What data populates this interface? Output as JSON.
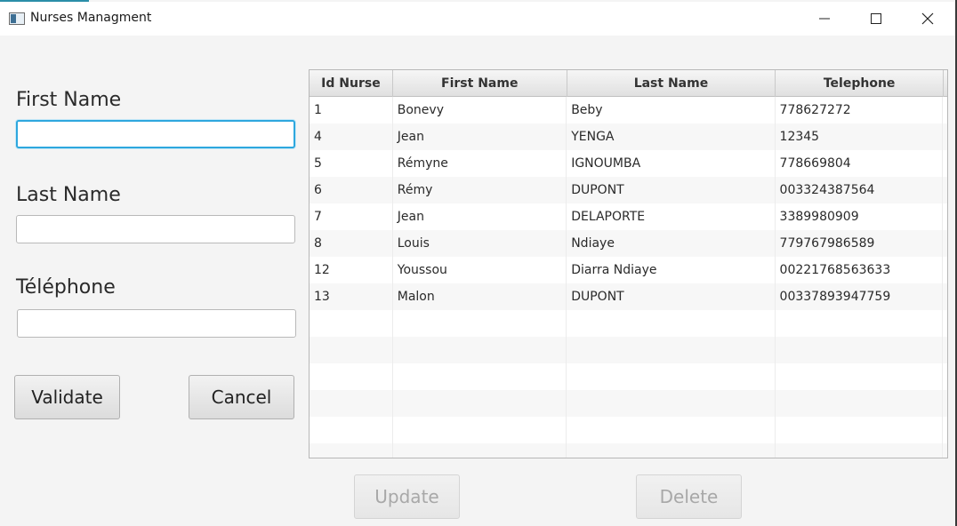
{
  "window": {
    "title": "Nurses Managment"
  },
  "form": {
    "first_name_label": "First Name",
    "first_name_value": "",
    "last_name_label": "Last Name",
    "last_name_value": "",
    "telephone_label": "Téléphone",
    "telephone_value": "",
    "validate_label": "Validate",
    "cancel_label": "Cancel"
  },
  "table": {
    "columns": [
      "Id Nurse",
      "First Name",
      "Last Name",
      "Telephone"
    ],
    "rows": [
      [
        "1",
        "Bonevy",
        "Beby",
        "778627272"
      ],
      [
        "4",
        "Jean",
        "YENGA",
        "12345"
      ],
      [
        "5",
        "Rémyne",
        "IGNOUMBA",
        "778669804"
      ],
      [
        "6",
        "Rémy",
        "DUPONT",
        "003324387564"
      ],
      [
        "7",
        "Jean",
        "DELAPORTE",
        "3389980909"
      ],
      [
        "8",
        "Louis",
        "Ndiaye",
        "779767986589"
      ],
      [
        "12",
        "Youssou",
        "Diarra Ndiaye",
        "00221768563633"
      ],
      [
        "13",
        "Malon",
        "DUPONT",
        "00337893947759"
      ]
    ]
  },
  "actions": {
    "update_label": "Update",
    "delete_label": "Delete"
  },
  "colors": {
    "focus_accent": "#2ea7de",
    "disabled_text": "#a8a8a8"
  }
}
